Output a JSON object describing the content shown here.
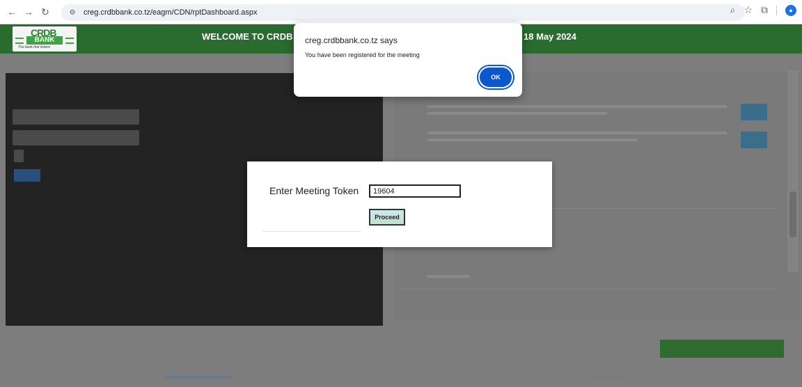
{
  "browser": {
    "url": "creg.crdbbank.co.tz/eagm/CDN/rptDashboard.aspx",
    "back_icon": "arrow-left",
    "forward_icon": "arrow-right",
    "reload_icon": "reload"
  },
  "header": {
    "logo_top": "CRDB",
    "logo_bank": "BANK",
    "logo_tagline": "The bank that listens",
    "title_left": "WELCOME TO CRDB",
    "title_right": "18 May 2024",
    "background": "#2a6b2f"
  },
  "token_modal": {
    "label": "Enter Meeting Token",
    "token_value": "19604",
    "proceed_label": "Proceed"
  },
  "alert": {
    "title": "creg.crdbbank.co.tz says",
    "message": "You have been registered for the meeting",
    "ok_label": "OK",
    "ok_color": "#0b57d0"
  }
}
